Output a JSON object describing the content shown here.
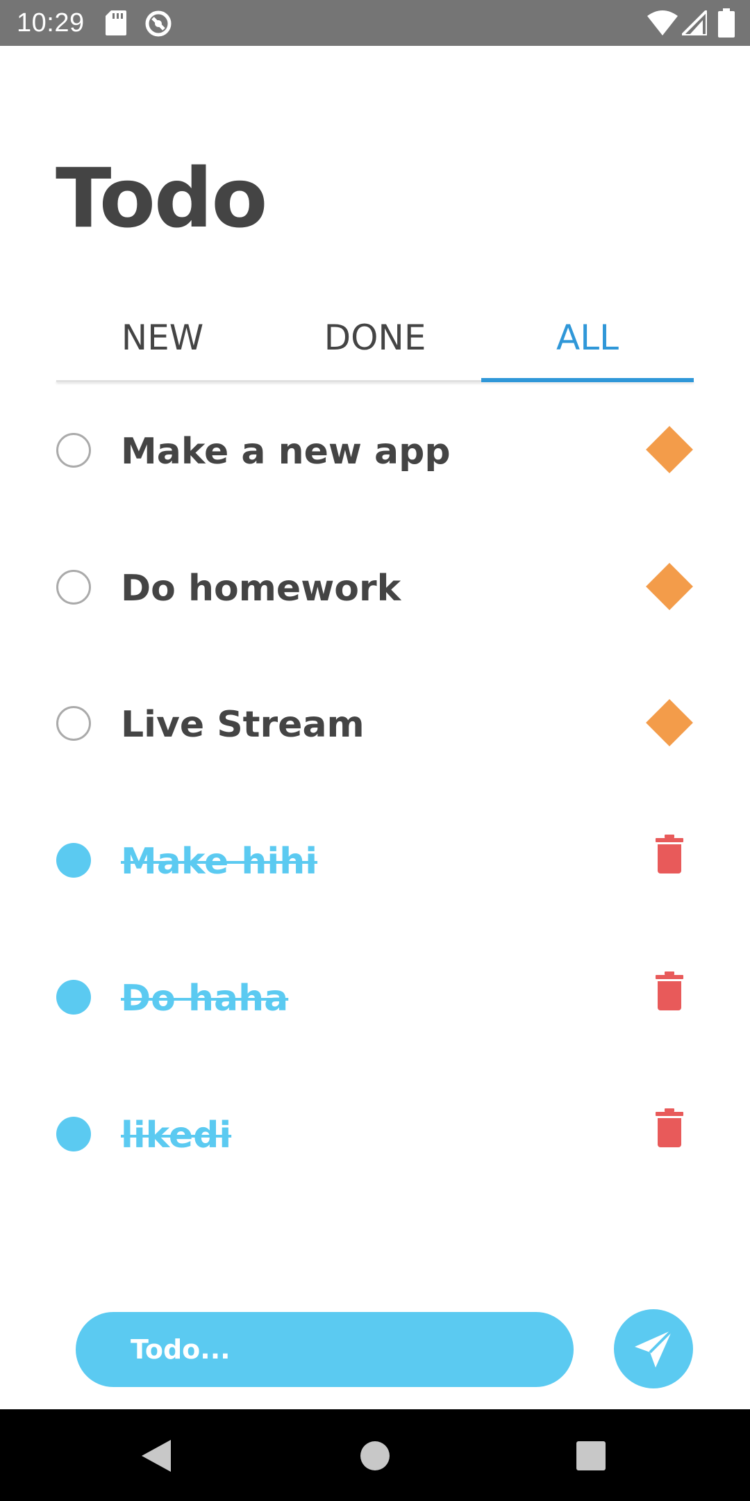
{
  "status_bar": {
    "time": "10:29",
    "left_icons": [
      "sd-card-icon",
      "sync-icon"
    ],
    "right_icons": [
      "wifi-icon",
      "signal-icon",
      "battery-icon"
    ]
  },
  "header": {
    "title": "Todo"
  },
  "tabs": {
    "items": [
      {
        "label": "NEW",
        "active": false
      },
      {
        "label": "DONE",
        "active": false
      },
      {
        "label": "ALL",
        "active": true
      }
    ],
    "active_color": "#2f97d8"
  },
  "todos": [
    {
      "text": "Make a new app",
      "done": false,
      "action_icon": "priority-diamond-icon"
    },
    {
      "text": "Do homework",
      "done": false,
      "action_icon": "priority-diamond-icon"
    },
    {
      "text": "Live Stream",
      "done": false,
      "action_icon": "priority-diamond-icon"
    },
    {
      "text": "Make  hihi",
      "done": true,
      "action_icon": "trash-icon"
    },
    {
      "text": "Do haha",
      "done": true,
      "action_icon": "trash-icon"
    },
    {
      "text": "likedi",
      "done": true,
      "action_icon": "trash-icon"
    }
  ],
  "composer": {
    "placeholder": "Todo...",
    "send_icon": "send-icon"
  },
  "nav_bar": {
    "icons": [
      "back-icon",
      "home-icon",
      "recents-icon"
    ]
  },
  "colors": {
    "accent": "#5bcaf1",
    "tab_active": "#2f97d8",
    "priority": "#f39c4a",
    "delete": "#e85a5a",
    "text": "#444444"
  }
}
